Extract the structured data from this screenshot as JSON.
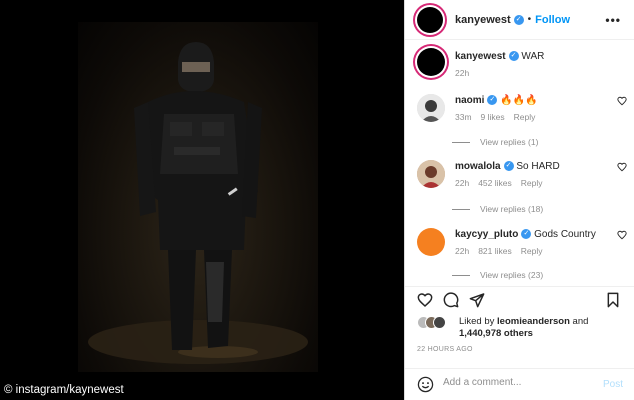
{
  "media": {
    "credit": "© instagram/kaynewest"
  },
  "header": {
    "username": "kanyewest",
    "separator": "•",
    "follow_label": "Follow",
    "more_label": "•••"
  },
  "caption": {
    "username": "kanyewest",
    "text": "WAR",
    "time": "22h"
  },
  "comments": [
    {
      "username": "naomi",
      "text": "🔥🔥🔥",
      "time": "33m",
      "likes": "9 likes",
      "reply": "Reply",
      "view_replies": "View replies (1)"
    },
    {
      "username": "mowalola",
      "text": "So HARD",
      "time": "22h",
      "likes": "452 likes",
      "reply": "Reply",
      "view_replies": "View replies (18)"
    },
    {
      "username": "kaycyy_pluto",
      "text": "Gods Country",
      "time": "22h",
      "likes": "821 likes",
      "reply": "Reply",
      "view_replies": "View replies (23)"
    }
  ],
  "likes": {
    "prefix": "Liked by",
    "user": "leomieanderson",
    "conj": "and",
    "count": "1,440,978 others"
  },
  "age": "22 HOURS AGO",
  "add_comment": {
    "placeholder": "Add a comment...",
    "post_label": "Post"
  },
  "colors": {
    "follow": "#0095f6",
    "verified": "#3897f0",
    "post_disabled": "#b2dffc",
    "story_ring": "#d62976"
  },
  "icons": {
    "actions": [
      "heart-icon",
      "comment-icon",
      "share-icon",
      "bookmark-icon"
    ],
    "emoji": "smiley-icon",
    "verified": "verified-badge-icon"
  }
}
